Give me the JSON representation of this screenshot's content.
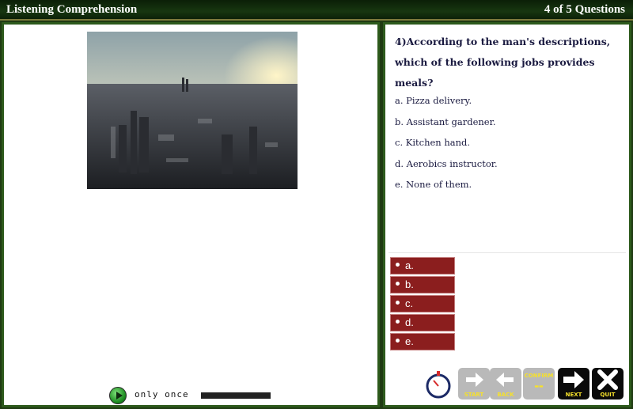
{
  "header": {
    "title": "Listening Comprehension",
    "counter": "4 of 5 Questions"
  },
  "audio": {
    "play_limit_label": "only once",
    "progress": 1.0
  },
  "question": {
    "text": "4)According to the man's descriptions, which of the following jobs provides meals?",
    "options": [
      "a. Pizza delivery.",
      "b. Assistant gardener.",
      "c. Kitchen hand.",
      "d. Aerobics instructor.",
      "e. None of them."
    ]
  },
  "answers": [
    "a.",
    "b.",
    "c.",
    "d.",
    "e."
  ],
  "toolbar": {
    "start_label": "START",
    "back_label": "BACK",
    "confirm_label": "CONFIRM",
    "next_label": "NEXT",
    "quit_label": "QUIT"
  },
  "colors": {
    "frame_green": "#2d5a1c",
    "answer_red": "#8b1e1e",
    "question_text": "#1a1a40"
  },
  "icons": [
    "play-icon",
    "timer-icon",
    "arrow-right-icon",
    "arrow-left-icon",
    "confirm-icon",
    "next-arrow-icon",
    "quit-x-icon"
  ]
}
